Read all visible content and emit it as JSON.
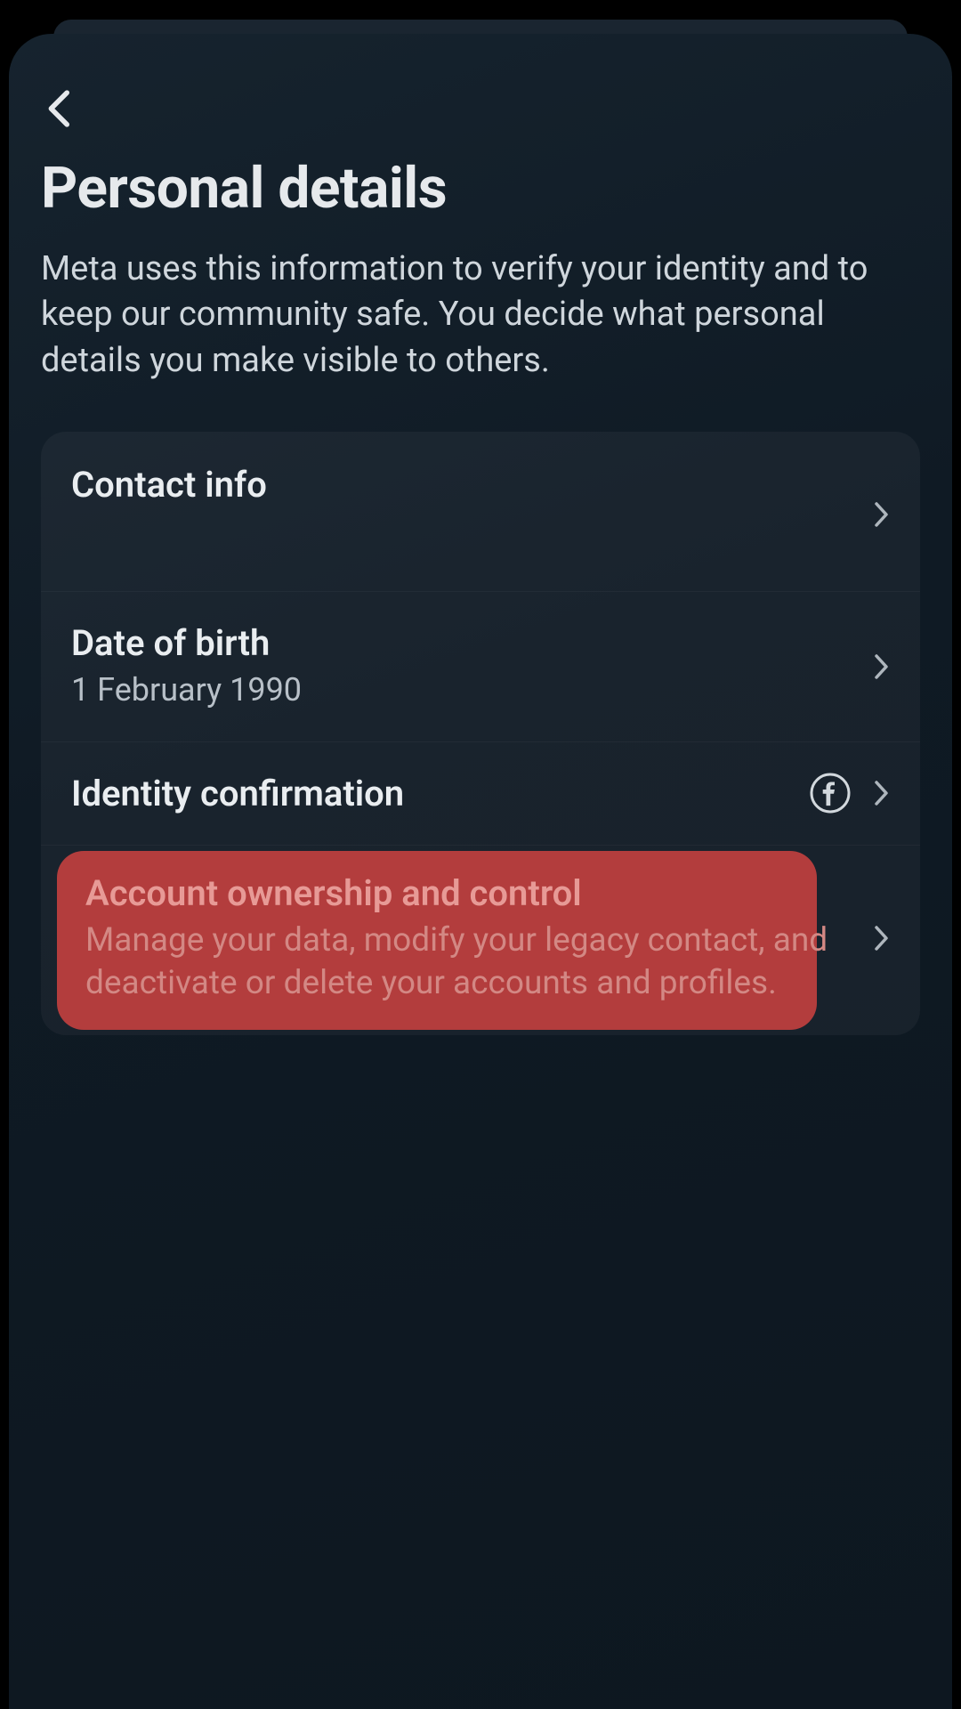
{
  "header": {
    "title": "Personal details",
    "description": "Meta uses this information to verify your identity and to keep our community safe. You decide what personal details you make visible to others."
  },
  "rows": {
    "contact": {
      "title": "Contact info"
    },
    "dob": {
      "title": "Date of birth",
      "value": "1 February 1990"
    },
    "identity": {
      "title": "Identity confirmation"
    },
    "ownership": {
      "title": "Account ownership and control",
      "description": "Manage your data, modify your legacy contact, and deactivate or delete your accounts and profiles."
    }
  }
}
